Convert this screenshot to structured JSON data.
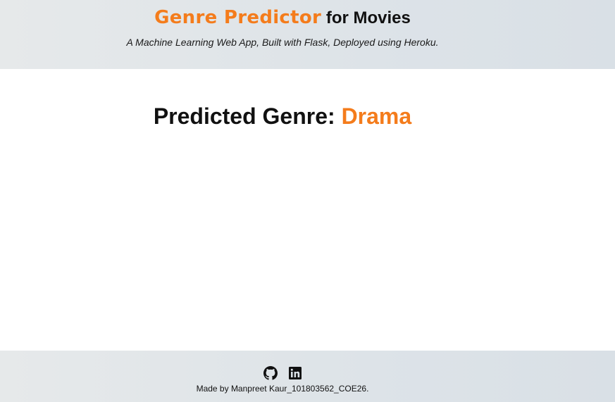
{
  "header": {
    "brand": "Genre Predictor",
    "brand_suffix": " for Movies",
    "tagline": "A Machine Learning Web App, Built with Flask, Deployed using Heroku."
  },
  "main": {
    "result_label": "Predicted Genre: ",
    "result_value": "Drama"
  },
  "footer": {
    "icons": [
      "github-icon",
      "linkedin-icon"
    ],
    "credit": "Made by Manpreet Kaur_101803562_COE26."
  },
  "colors": {
    "accent": "#f47c1c",
    "text": "#111111",
    "band": "#dde3e8"
  }
}
